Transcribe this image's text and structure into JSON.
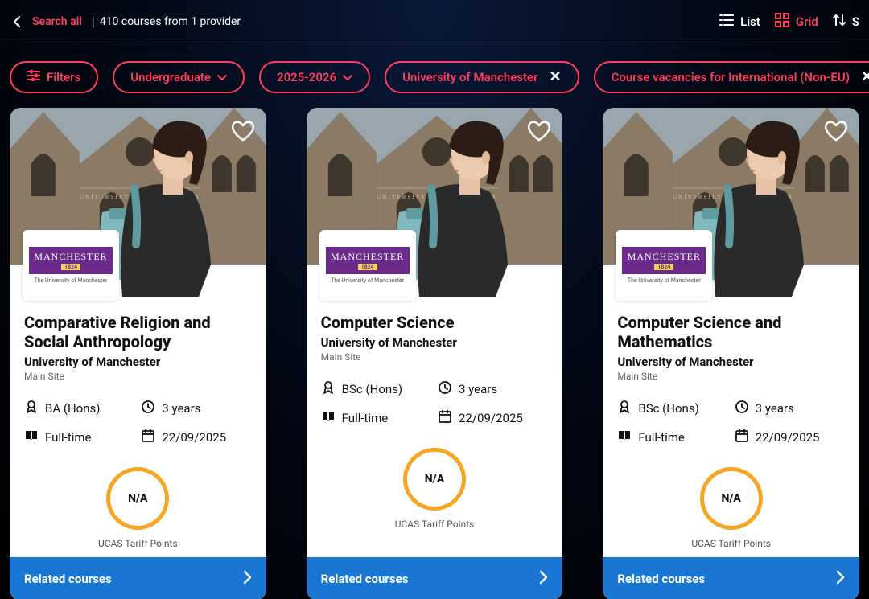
{
  "topbar": {
    "search_all": "Search all",
    "result_count": "410 courses from 1 provider",
    "list_label": "List",
    "grid_label": "Grid",
    "sort_label": "S"
  },
  "filters": {
    "filters_label": "Filters",
    "level": "Undergraduate",
    "year": "2025-2026",
    "university": "University of Manchester",
    "vacancies": "Course vacancies for International (Non-EU)",
    "clear_label": "Cl"
  },
  "logo": {
    "text": "MANCHESTER",
    "year": "1824",
    "sub": "The University of Manchester"
  },
  "ucas_label": "UCAS Tariff Points",
  "related_label": "Related courses",
  "cards": [
    {
      "title": "Comparative Religion and Social Anthropology",
      "uni": "University of Manchester",
      "site": "Main Site",
      "award": "BA (Hons)",
      "duration": "3 years",
      "mode": "Full-time",
      "start": "22/09/2025",
      "ucas": "N/A"
    },
    {
      "title": "Computer Science",
      "uni": "University of Manchester",
      "site": "Main Site",
      "award": "BSc (Hons)",
      "duration": "3 years",
      "mode": "Full-time",
      "start": "22/09/2025",
      "ucas": "N/A"
    },
    {
      "title": "Computer Science and Mathematics",
      "uni": "University of Manchester",
      "site": "Main Site",
      "award": "BSc (Hons)",
      "duration": "3 years",
      "mode": "Full-time",
      "start": "22/09/2025",
      "ucas": "N/A"
    }
  ]
}
